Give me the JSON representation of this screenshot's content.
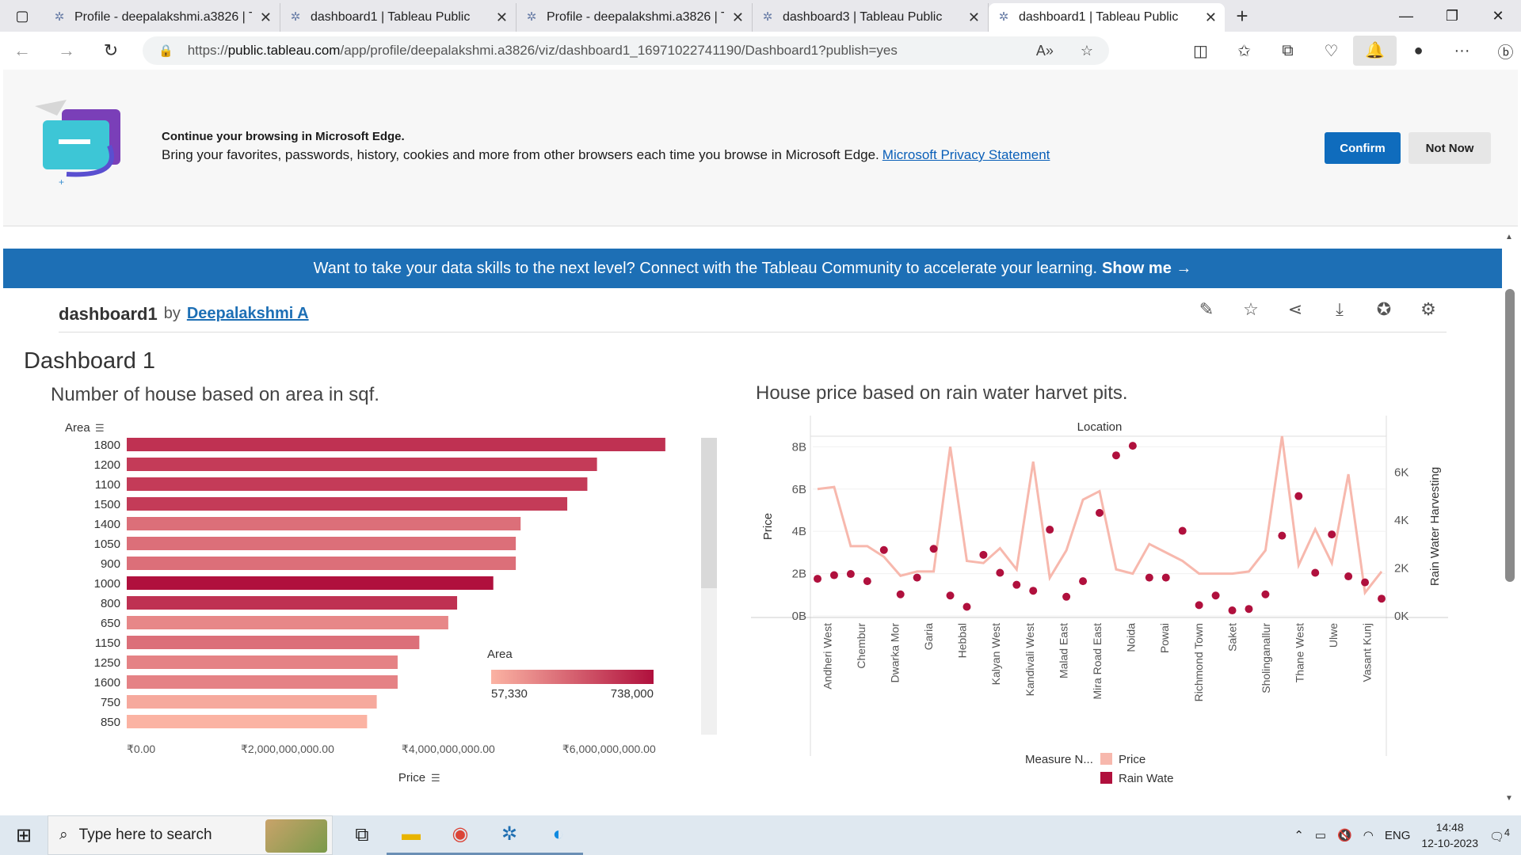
{
  "browser": {
    "tabs": [
      {
        "title": "Profile - deepalakshmi.a3826 | Ta",
        "active": false
      },
      {
        "title": "dashboard1 | Tableau Public",
        "active": false
      },
      {
        "title": "Profile - deepalakshmi.a3826 | Ta",
        "active": false
      },
      {
        "title": "dashboard3 | Tableau Public",
        "active": false
      },
      {
        "title": "dashboard1 | Tableau Public",
        "active": true
      }
    ],
    "url_prefix": "https://",
    "url_domain": "public.tableau.com",
    "url_path": "/app/profile/deepalakshmi.a3826/viz/dashboard1_16971022741190/Dashboard1?publish=yes"
  },
  "edge_prompt": {
    "title": "Continue your browsing in Microsoft Edge.",
    "text": "Bring your favorites, passwords, history, cookies and more from other browsers each time you browse in Microsoft Edge.",
    "link": "Microsoft Privacy Statement",
    "confirm": "Confirm",
    "not_now": "Not Now"
  },
  "banner": {
    "text": "Want to take your data skills to the next level? Connect with the Tableau Community to accelerate your learning.",
    "cta": "Show me →"
  },
  "viz": {
    "name": "dashboard1",
    "by": "by",
    "author": "Deepalakshmi A",
    "dashboard_title": "Dashboard 1"
  },
  "chart_data": [
    {
      "type": "bar",
      "title": "Number of house based on area in sqf.",
      "ylabel": "Area",
      "xlabel": "Price",
      "categories": [
        "1800",
        "1200",
        "1100",
        "1500",
        "1400",
        "1050",
        "900",
        "1000",
        "800",
        "650",
        "1150",
        "1250",
        "1600",
        "750",
        "850"
      ],
      "values": [
        6700000000,
        5850000000,
        5730000000,
        5480000000,
        4900000000,
        4840000000,
        4840000000,
        4560000000,
        4110000000,
        4000000000,
        3640000000,
        3370000000,
        3370000000,
        3110000000,
        2990000000
      ],
      "color_values": [
        600000,
        560000,
        560000,
        560000,
        340000,
        340000,
        340000,
        738000,
        600000,
        240000,
        340000,
        260000,
        260000,
        100000,
        57330
      ],
      "xlim": [
        0,
        6800000000
      ],
      "x_ticks": [
        "₹0.00",
        "₹2,000,000,000.00",
        "₹4,000,000,000.00",
        "₹6,000,000,000.00"
      ],
      "x_tick_values": [
        0,
        2000000000,
        4000000000,
        6000000000
      ],
      "legend": {
        "title": "Area",
        "min_label": "57,330",
        "max_label": "738,000",
        "min_color": "#fbb3a3",
        "max_color": "#b0103d"
      }
    },
    {
      "type": "line",
      "title": "House price based on rain water harvet pits.",
      "header": "Location",
      "ylabel_left": "Price",
      "ylabel_right": "Rain Water Harvesting",
      "y_left_ticks": [
        "0B",
        "2B",
        "4B",
        "6B",
        "8B"
      ],
      "y_left_values": [
        0,
        2000000000,
        4000000000,
        6000000000,
        8000000000
      ],
      "y_right_ticks": [
        "0K",
        "2K",
        "4K",
        "6K"
      ],
      "y_right_values": [
        0,
        2000,
        4000,
        6000
      ],
      "y_left_lim": [
        0,
        8500000000
      ],
      "y_right_lim": [
        0,
        7500
      ],
      "x_labels": [
        "Andheri West",
        "Chembur",
        "Dwarka Mor",
        "Garia",
        "Hebbal",
        "Kalyan West",
        "Kandivali West",
        "Malad East",
        "Mira Road East",
        "Noida",
        "Powai",
        "Richmond Town",
        "Saket",
        "Sholinganallur",
        "Thane West",
        "Ulwe",
        "Vasant Kunj"
      ],
      "n_points": 35,
      "series": [
        {
          "name": "Price",
          "color": "#f7b8ad",
          "axis": "left",
          "values": [
            6000000000,
            6100000000,
            3300000000,
            3300000000,
            2800000000,
            1900000000,
            2100000000,
            2100000000,
            8000000000,
            2600000000,
            2500000000,
            3200000000,
            2200000000,
            7300000000,
            1800000000,
            3100000000,
            5500000000,
            5900000000,
            2200000000,
            2000000000,
            3400000000,
            3000000000,
            2600000000,
            2000000000,
            2000000000,
            2000000000,
            2100000000,
            3100000000,
            8500000000,
            2400000000,
            4100000000,
            2500000000,
            6700000000,
            1100000000,
            2100000000
          ]
        },
        {
          "name": "Rain Wate",
          "color": "#b0103d",
          "axis": "right",
          "values": [
            1550,
            1700,
            1750,
            1450,
            2750,
            900,
            1600,
            2800,
            850,
            380,
            2550,
            1800,
            1300,
            1050,
            3600,
            800,
            1450,
            4300,
            6700,
            7100,
            1600,
            1600,
            3550,
            450,
            850,
            230,
            290,
            900,
            3350,
            5000,
            1800,
            3400,
            1650,
            1400,
            720
          ]
        }
      ],
      "legend": {
        "title": "Measure N...",
        "items": [
          "Price",
          "Rain Wate"
        ]
      }
    }
  ],
  "taskbar": {
    "search_placeholder": "Type here to search",
    "lang": "ENG",
    "time": "14:48",
    "date": "12-10-2023",
    "notif_count": "4"
  }
}
